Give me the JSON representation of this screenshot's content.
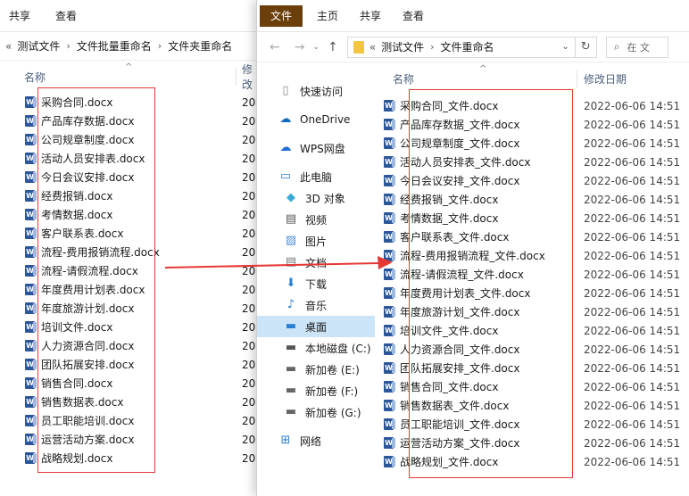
{
  "back_window": {
    "ribbon": {
      "tabs": [
        "共享",
        "查看"
      ]
    },
    "breadcrumb": {
      "parts": [
        "测试文件",
        "文件批量重命名",
        "文件夹重命名"
      ]
    },
    "columns": {
      "name": "名称",
      "modified": "修改"
    },
    "files": [
      "采购合同.docx",
      "产品库存数据.docx",
      "公司规章制度.docx",
      "活动人员安排表.docx",
      "今日会议安排.docx",
      "经费报销.docx",
      "考情数据.docx",
      "客户联系表.docx",
      "流程-费用报销流程.docx",
      "流程-请假流程.docx",
      "年度费用计划表.docx",
      "年度旅游计划.docx",
      "培训文件.docx",
      "人力资源合同.docx",
      "团队拓展安排.docx",
      "销售合同.docx",
      "销售数据表.docx",
      "员工职能培训.docx",
      "运营活动方案.docx",
      "战略规划.docx"
    ],
    "date_stub": "20"
  },
  "front_window": {
    "ribbon": {
      "file": "文件",
      "tabs": [
        "主页",
        "共享",
        "查看"
      ]
    },
    "breadcrumb": {
      "parts": [
        "测试文件",
        "文件重命名"
      ]
    },
    "search": {
      "placeholder": "在 文"
    },
    "columns": {
      "name": "名称",
      "modified": "修改日期"
    },
    "nav": [
      {
        "label": "快速访问",
        "icon": "document-icon"
      },
      {
        "label": "OneDrive",
        "icon": "onedrive-cloud-icon"
      },
      {
        "label": "WPS网盘",
        "icon": "wps-cloud-icon"
      },
      {
        "label": "此电脑",
        "icon": "computer-icon"
      },
      {
        "label": "3D 对象",
        "icon": "cube-3d-icon"
      },
      {
        "label": "视频",
        "icon": "video-icon"
      },
      {
        "label": "图片",
        "icon": "pictures-icon"
      },
      {
        "label": "文档",
        "icon": "documents-icon"
      },
      {
        "label": "下载",
        "icon": "download-icon"
      },
      {
        "label": "音乐",
        "icon": "music-icon"
      },
      {
        "label": "桌面",
        "icon": "desktop-icon"
      },
      {
        "label": "本地磁盘 (C:)",
        "icon": "local-disk-icon"
      },
      {
        "label": "新加卷 (E:)",
        "icon": "drive-icon"
      },
      {
        "label": "新加卷 (F:)",
        "icon": "drive-icon"
      },
      {
        "label": "新加卷 (G:)",
        "icon": "drive-icon"
      },
      {
        "label": "网络",
        "icon": "network-icon"
      }
    ],
    "files": [
      {
        "name": "采购合同_文件.docx",
        "date": "2022-06-06 14:51"
      },
      {
        "name": "产品库存数据_文件.docx",
        "date": "2022-06-06 14:51"
      },
      {
        "name": "公司规章制度_文件.docx",
        "date": "2022-06-06 14:51"
      },
      {
        "name": "活动人员安排表_文件.docx",
        "date": "2022-06-06 14:51"
      },
      {
        "name": "今日会议安排_文件.docx",
        "date": "2022-06-06 14:51"
      },
      {
        "name": "经费报销_文件.docx",
        "date": "2022-06-06 14:51"
      },
      {
        "name": "考情数据_文件.docx",
        "date": "2022-06-06 14:51"
      },
      {
        "name": "客户联系表_文件.docx",
        "date": "2022-06-06 14:51"
      },
      {
        "name": "流程-费用报销流程_文件.docx",
        "date": "2022-06-06 14:51"
      },
      {
        "name": "流程-请假流程_文件.docx",
        "date": "2022-06-06 14:51"
      },
      {
        "name": "年度费用计划表_文件.docx",
        "date": "2022-06-06 14:51"
      },
      {
        "name": "年度旅游计划_文件.docx",
        "date": "2022-06-06 14:51"
      },
      {
        "name": "培训文件_文件.docx",
        "date": "2022-06-06 14:51"
      },
      {
        "name": "人力资源合同_文件.docx",
        "date": "2022-06-06 14:51"
      },
      {
        "name": "团队拓展安排_文件.docx",
        "date": "2022-06-06 14:51"
      },
      {
        "name": "销售合同_文件.docx",
        "date": "2022-06-06 14:51"
      },
      {
        "name": "销售数据表_文件.docx",
        "date": "2022-06-06 14:51"
      },
      {
        "name": "员工职能培训_文件.docx",
        "date": "2022-06-06 14:51"
      },
      {
        "name": "运营活动方案_文件.docx",
        "date": "2022-06-06 14:51"
      },
      {
        "name": "战略规划_文件.docx",
        "date": "2022-06-06 14:51"
      }
    ]
  },
  "colors": {
    "highlight_box": "#e53935",
    "arrow": "#e53935",
    "file_tab": "#6b3f0a",
    "selected_nav": "#cce4f7",
    "word_icon": "#2b579a"
  }
}
